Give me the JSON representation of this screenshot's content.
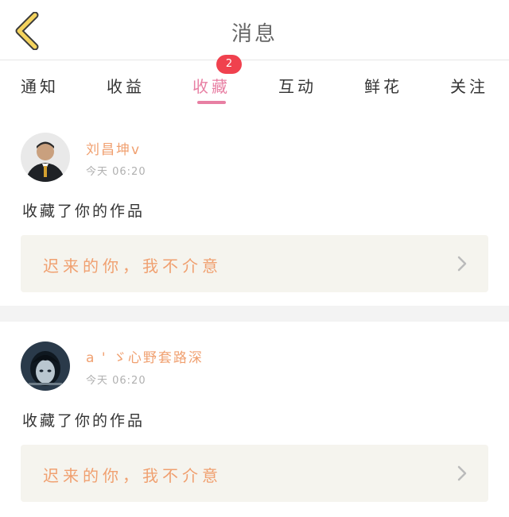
{
  "header": {
    "title": "消息",
    "back_icon": "chevron-left-icon",
    "back_icon_color": "#f4d35e"
  },
  "tabs": [
    {
      "label": "通知",
      "active": false
    },
    {
      "label": "收益",
      "active": false
    },
    {
      "label": "收藏",
      "active": true,
      "badge": "2"
    },
    {
      "label": "互动",
      "active": false
    },
    {
      "label": "鲜花",
      "active": false
    },
    {
      "label": "关注",
      "active": false
    }
  ],
  "messages": [
    {
      "username": "刘昌坤v",
      "timestamp": "今天  06:20",
      "action": "收藏了你的作品",
      "work_title": "迟来的你，我不介意",
      "avatar": "avatar-icon"
    },
    {
      "username": "a ' ゞ心野套路深",
      "timestamp": "今天  06:20",
      "action": "收藏了你的作品",
      "work_title": "迟来的你，我不介意",
      "avatar": "avatar-icon"
    }
  ],
  "colors": {
    "accent_pink": "#e87fa3",
    "username_orange": "#f0a070",
    "badge_red": "#f0414e",
    "work_box_bg": "#f5f4ee"
  }
}
